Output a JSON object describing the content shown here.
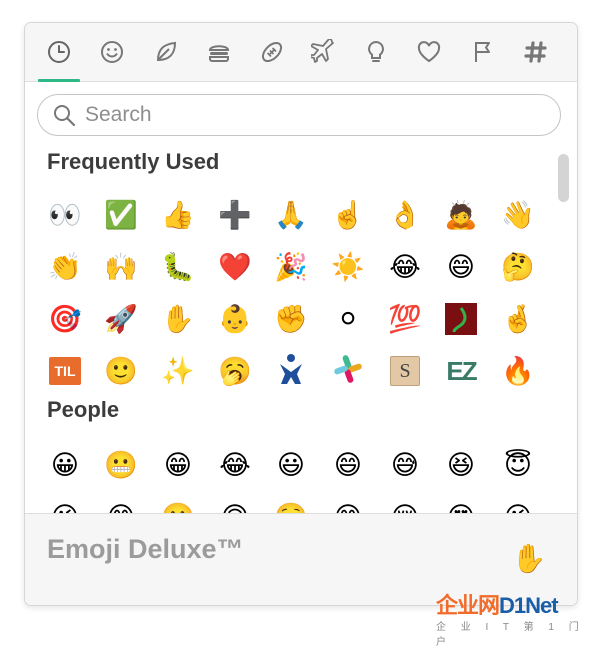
{
  "tabs": [
    {
      "name": "clock-icon",
      "active": true
    },
    {
      "name": "smiley-icon",
      "active": false
    },
    {
      "name": "leaf-icon",
      "active": false
    },
    {
      "name": "burger-icon",
      "active": false
    },
    {
      "name": "football-icon",
      "active": false
    },
    {
      "name": "airplane-icon",
      "active": false
    },
    {
      "name": "lightbulb-icon",
      "active": false
    },
    {
      "name": "heart-icon",
      "active": false
    },
    {
      "name": "flag-icon",
      "active": false
    },
    {
      "name": "slack-hash-icon",
      "active": false
    }
  ],
  "colors": {
    "accent": "#2eb886",
    "heading": "#3c3c3c",
    "footer_text": "#9b9b9b"
  },
  "search": {
    "placeholder": "Search",
    "value": ""
  },
  "sections": {
    "frequently_used": {
      "title": "Frequently Used",
      "emojis": [
        "👀",
        "✅",
        "👍",
        "➕",
        "🙏",
        "☝️",
        "👌",
        "🙇",
        "👋",
        "👏",
        "🙌",
        "🐛",
        "❤️",
        "🎉",
        "☀️",
        "😂",
        "😄",
        "🤔",
        "🎯",
        "🚀",
        "✋",
        "👶",
        "✊",
        "⚪",
        "💯",
        "custom:redbox",
        "🤞",
        "custom:til",
        "🙂",
        "✨",
        "🥱",
        "custom:jira",
        "custom:slack",
        "custom:s1",
        "custom:ez",
        "🔥"
      ]
    },
    "people": {
      "title": "People",
      "emojis": [
        "😀",
        "😬",
        "😁",
        "😂",
        "😃",
        "😄",
        "😅",
        "😆",
        "😇",
        "😉",
        "😊",
        "🙂",
        "🙃",
        "☺️",
        "😋",
        "😌",
        "😍",
        "😘"
      ]
    }
  },
  "custom_labels": {
    "til": "TIL",
    "s1": "S",
    "ez": "EZ"
  },
  "footer": {
    "title": "Emoji Deluxe™",
    "skin_tone": "✋"
  },
  "watermark": {
    "main_a": "企业网",
    "main_b": "D1Net",
    "sub": "企 业 I T 第 1 门 户"
  }
}
